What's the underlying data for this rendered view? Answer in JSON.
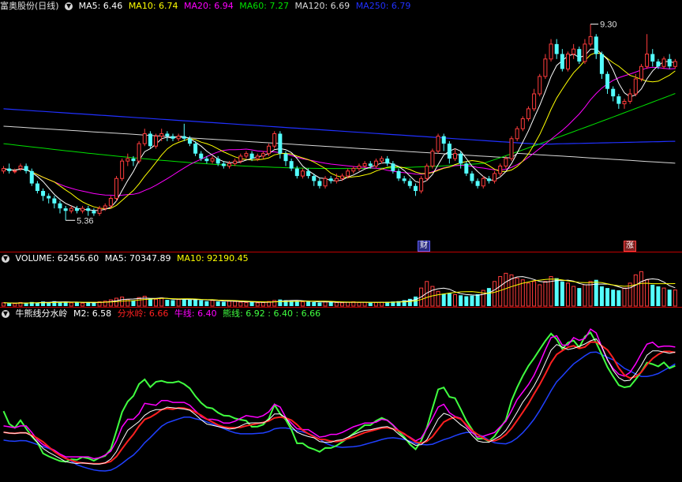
{
  "main_header": {
    "stock": "富奥股份(日线)",
    "ma5": "MA5: 6.46",
    "ma10": "MA10: 6.74",
    "ma20": "MA20: 6.94",
    "ma60": "MA60: 7.27",
    "ma120": "MA120: 6.69",
    "ma250": "MA250: 6.79"
  },
  "volume_header": {
    "volume": "VOLUME: 62456.60",
    "ma5": "MA5: 70347.89",
    "ma10": "MA10: 92190.45"
  },
  "indicator_header": {
    "name": "牛熊线分水岭",
    "m2": "M2: 6.58",
    "fsl": "分水岭: 6.66",
    "niu": "牛线: 6.40",
    "xiong": "熊线: 6.92 : 6.40 : 6.66"
  },
  "annotations": {
    "high": "9.30",
    "low": "5.36",
    "flag_cai": "财",
    "flag_zhang": "涨"
  },
  "colors": {
    "up": "#ff3c3c",
    "down": "#54ffff",
    "ma5": "#ffffff",
    "ma10": "#ffff00",
    "ma20": "#ff00ff",
    "ma60": "#00e000",
    "ma120": "#d8d8d8",
    "ma250": "#2030ff",
    "fsl": "#ff2020",
    "niu": "#ff00ff",
    "xiong": "#40ff40",
    "m2": "#ffffff",
    "blue_line": "#2040ff"
  },
  "chart_data": {
    "type": "candlestick",
    "price_range": [
      5.0,
      9.5
    ],
    "high": 9.3,
    "low": 5.36,
    "candles": [
      [
        6.35,
        6.4,
        6.3,
        6.45
      ],
      [
        6.4,
        6.35,
        6.3,
        6.5
      ],
      [
        6.35,
        6.35,
        6.3,
        6.4
      ],
      [
        6.4,
        6.45,
        6.35,
        6.5
      ],
      [
        6.45,
        6.35,
        6.3,
        6.5
      ],
      [
        6.35,
        6.1,
        6.05,
        6.4
      ],
      [
        6.1,
        5.95,
        5.9,
        6.15
      ],
      [
        5.95,
        5.85,
        5.75,
        6.0
      ],
      [
        5.85,
        5.8,
        5.7,
        5.9
      ],
      [
        5.8,
        5.7,
        5.6,
        5.85
      ],
      [
        5.7,
        5.6,
        5.5,
        5.75
      ],
      [
        5.6,
        5.55,
        5.36,
        5.65
      ],
      [
        5.55,
        5.6,
        5.5,
        5.65
      ],
      [
        5.6,
        5.55,
        5.5,
        5.65
      ],
      [
        5.55,
        5.6,
        5.5,
        5.65
      ],
      [
        5.6,
        5.55,
        5.45,
        5.65
      ],
      [
        5.55,
        5.5,
        5.45,
        5.6
      ],
      [
        5.5,
        5.6,
        5.45,
        5.65
      ],
      [
        5.6,
        5.65,
        5.55,
        5.7
      ],
      [
        5.65,
        5.8,
        5.6,
        5.85
      ],
      [
        5.8,
        6.2,
        5.75,
        6.25
      ],
      [
        6.2,
        6.55,
        6.15,
        6.6
      ],
      [
        6.55,
        6.6,
        6.45,
        6.7
      ],
      [
        6.6,
        6.55,
        6.45,
        6.65
      ],
      [
        6.55,
        6.9,
        6.5,
        6.95
      ],
      [
        6.9,
        7.1,
        6.85,
        7.2
      ],
      [
        7.1,
        6.85,
        6.8,
        7.15
      ],
      [
        6.85,
        7.05,
        6.8,
        7.1
      ],
      [
        7.05,
        7.1,
        6.95,
        7.2
      ],
      [
        7.1,
        7.05,
        6.95,
        7.15
      ],
      [
        7.05,
        7.0,
        6.95,
        7.1
      ],
      [
        7.0,
        7.05,
        6.95,
        7.1
      ],
      [
        7.05,
        7.0,
        6.95,
        7.3
      ],
      [
        7.0,
        6.9,
        6.85,
        7.05
      ],
      [
        6.9,
        6.7,
        6.65,
        6.95
      ],
      [
        6.7,
        6.6,
        6.55,
        6.75
      ],
      [
        6.6,
        6.55,
        6.5,
        6.65
      ],
      [
        6.55,
        6.6,
        6.5,
        6.65
      ],
      [
        6.6,
        6.5,
        6.45,
        6.65
      ],
      [
        6.5,
        6.45,
        6.4,
        6.55
      ],
      [
        6.45,
        6.5,
        6.4,
        6.55
      ],
      [
        6.5,
        6.55,
        6.45,
        6.6
      ],
      [
        6.55,
        6.65,
        6.5,
        6.7
      ],
      [
        6.65,
        6.7,
        6.6,
        6.75
      ],
      [
        6.7,
        6.6,
        6.55,
        6.75
      ],
      [
        6.6,
        6.65,
        6.55,
        6.7
      ],
      [
        6.65,
        6.7,
        6.6,
        6.75
      ],
      [
        6.7,
        6.85,
        6.65,
        6.9
      ],
      [
        6.85,
        7.1,
        6.8,
        7.15
      ],
      [
        7.1,
        6.7,
        6.6,
        7.15
      ],
      [
        6.7,
        6.55,
        6.45,
        6.75
      ],
      [
        6.55,
        6.4,
        6.35,
        6.6
      ],
      [
        6.4,
        6.25,
        6.2,
        6.45
      ],
      [
        6.25,
        6.35,
        6.2,
        6.4
      ],
      [
        6.35,
        6.25,
        6.2,
        6.4
      ],
      [
        6.25,
        6.15,
        6.05,
        6.3
      ],
      [
        6.15,
        6.05,
        6.0,
        6.2
      ],
      [
        6.05,
        6.2,
        6.0,
        6.25
      ],
      [
        6.2,
        6.15,
        6.1,
        6.25
      ],
      [
        6.15,
        6.2,
        6.1,
        6.3
      ],
      [
        6.2,
        6.25,
        6.15,
        6.3
      ],
      [
        6.25,
        6.35,
        6.2,
        6.4
      ],
      [
        6.35,
        6.4,
        6.3,
        6.45
      ],
      [
        6.4,
        6.45,
        6.35,
        6.5
      ],
      [
        6.45,
        6.5,
        6.4,
        6.55
      ],
      [
        6.5,
        6.45,
        6.4,
        6.55
      ],
      [
        6.45,
        6.55,
        6.4,
        6.6
      ],
      [
        6.55,
        6.6,
        6.5,
        6.65
      ],
      [
        6.6,
        6.5,
        6.45,
        6.65
      ],
      [
        6.5,
        6.35,
        6.3,
        6.55
      ],
      [
        6.35,
        6.2,
        6.15,
        6.4
      ],
      [
        6.2,
        6.15,
        6.1,
        6.25
      ],
      [
        6.15,
        6.05,
        6.0,
        6.2
      ],
      [
        6.05,
        5.95,
        5.85,
        6.1
      ],
      [
        5.95,
        6.2,
        5.9,
        6.25
      ],
      [
        6.2,
        6.45,
        6.15,
        6.5
      ],
      [
        6.45,
        6.75,
        6.4,
        6.8
      ],
      [
        6.75,
        7.05,
        6.7,
        7.1
      ],
      [
        7.05,
        6.9,
        6.75,
        7.1
      ],
      [
        6.9,
        6.6,
        6.5,
        6.95
      ],
      [
        6.6,
        6.7,
        6.55,
        6.8
      ],
      [
        6.7,
        6.5,
        6.4,
        6.75
      ],
      [
        6.5,
        6.3,
        6.25,
        6.55
      ],
      [
        6.3,
        6.15,
        6.1,
        6.35
      ],
      [
        6.15,
        6.05,
        6.0,
        6.2
      ],
      [
        6.05,
        6.2,
        6.0,
        6.25
      ],
      [
        6.2,
        6.15,
        6.1,
        6.25
      ],
      [
        6.15,
        6.3,
        6.1,
        6.35
      ],
      [
        6.3,
        6.45,
        6.25,
        6.5
      ],
      [
        6.45,
        6.6,
        6.4,
        6.65
      ],
      [
        6.6,
        7.0,
        6.55,
        7.05
      ],
      [
        7.0,
        7.2,
        6.95,
        7.25
      ],
      [
        7.2,
        7.4,
        7.15,
        7.45
      ],
      [
        7.4,
        7.6,
        7.35,
        7.65
      ],
      [
        7.6,
        7.9,
        7.55,
        8.0
      ],
      [
        7.9,
        8.25,
        7.85,
        8.3
      ],
      [
        8.25,
        8.6,
        8.2,
        8.7
      ],
      [
        8.6,
        8.9,
        8.55,
        9.0
      ],
      [
        8.9,
        8.7,
        8.6,
        9.0
      ],
      [
        8.7,
        8.4,
        8.35,
        8.8
      ],
      [
        8.4,
        8.7,
        8.35,
        8.75
      ],
      [
        8.7,
        8.8,
        8.6,
        8.9
      ],
      [
        8.8,
        8.55,
        8.5,
        8.85
      ],
      [
        8.55,
        8.9,
        8.5,
        9.0
      ],
      [
        8.9,
        9.05,
        8.85,
        9.3
      ],
      [
        9.05,
        8.7,
        8.6,
        9.1
      ],
      [
        8.7,
        8.3,
        8.2,
        8.75
      ],
      [
        8.3,
        8.0,
        7.9,
        8.35
      ],
      [
        8.0,
        7.85,
        7.75,
        8.05
      ],
      [
        7.85,
        7.7,
        7.6,
        7.9
      ],
      [
        7.7,
        7.75,
        7.6,
        7.8
      ],
      [
        7.75,
        7.9,
        7.7,
        8.0
      ],
      [
        7.9,
        8.2,
        7.85,
        8.3
      ],
      [
        8.2,
        8.45,
        8.15,
        8.5
      ],
      [
        8.45,
        8.7,
        8.4,
        9.1
      ],
      [
        8.7,
        8.55,
        8.45,
        8.8
      ],
      [
        8.55,
        8.45,
        8.4,
        8.6
      ],
      [
        8.45,
        8.6,
        8.4,
        8.65
      ],
      [
        8.6,
        8.45,
        8.4,
        8.7
      ],
      [
        8.45,
        8.55,
        8.4,
        8.6
      ]
    ],
    "volume_range": [
      0,
      250000
    ],
    "volumes": [
      20,
      18,
      15,
      22,
      18,
      25,
      20,
      28,
      22,
      30,
      26,
      24,
      20,
      22,
      18,
      24,
      20,
      26,
      30,
      38,
      48,
      55,
      40,
      35,
      52,
      60,
      45,
      42,
      50,
      38,
      36,
      40,
      44,
      38,
      42,
      36,
      30,
      34,
      28,
      26,
      30,
      28,
      24,
      22,
      26,
      20,
      22,
      28,
      34,
      40,
      36,
      32,
      30,
      26,
      28,
      24,
      22,
      26,
      24,
      22,
      20,
      24,
      26,
      22,
      24,
      20,
      22,
      24,
      26,
      28,
      30,
      36,
      44,
      58,
      110,
      150,
      120,
      90,
      75,
      80,
      70,
      66,
      60,
      64,
      72,
      96,
      110,
      150,
      180,
      200,
      190,
      170,
      160,
      140,
      150,
      130,
      150,
      180,
      170,
      150,
      140,
      120,
      110,
      130,
      150,
      160,
      120,
      110,
      100,
      96,
      110,
      140,
      190,
      210,
      160,
      130,
      120,
      110,
      100,
      98
    ],
    "indicator_range": [
      0,
      100
    ]
  }
}
